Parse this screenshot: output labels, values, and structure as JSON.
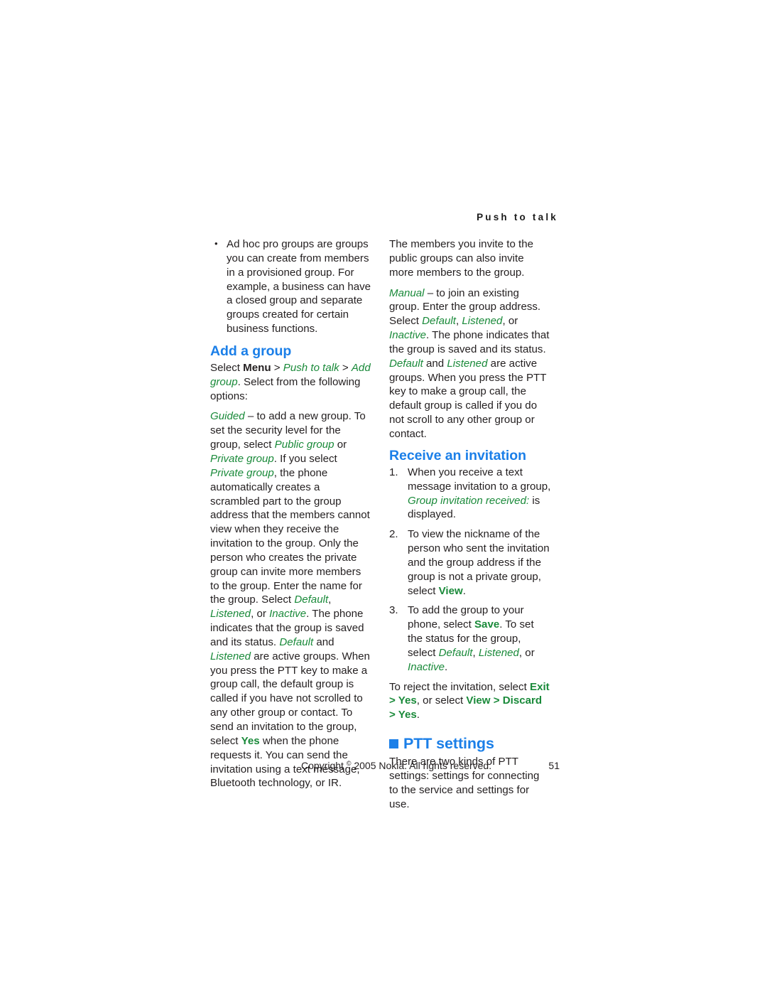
{
  "header": {
    "running_head": "Push to talk"
  },
  "left_column": {
    "bullet_items": [
      "Ad hoc pro groups are groups you can create from members in a provisioned group. For example, a business can have a closed group and separate groups created for certain business functions."
    ],
    "heading_add_group": "Add a group",
    "select_para": {
      "t1": "Select ",
      "menu": "Menu",
      "t2": " > ",
      "push_to_talk": "Push to talk",
      "t3": " > ",
      "add_group": "Add group",
      "t4": ". Select from the following options:"
    },
    "guided_para": {
      "guided": "Guided",
      "t1": " – to add a new group. To set the security level for the group, select ",
      "public_group": "Public group",
      "t2": " or ",
      "private_group": "Private group",
      "t3": ". If you select ",
      "private_group2": "Private group",
      "t4": ", the phone automatically creates a scrambled part to the group address that the members cannot view when they receive the invitation to the group. Only the person who creates the private group can invite more members to the group. Enter the name for the group. Select ",
      "default1": "Default",
      "t5": ", ",
      "listened1": "Listened",
      "t6": ", or ",
      "inactive1": "Inactive",
      "t7": ". The phone indicates that the group is saved and its status. ",
      "default2": "Default",
      "t8": " and ",
      "listened2": "Listened",
      "t9": " are active groups. When you press the PTT key to make a group call, the default group is called if you have not scrolled to any other group or contact. To send an invitation to the group, select ",
      "yes": "Yes",
      "t10": " when the phone requests it. You can send the invitation using a text message, Bluetooth technology, or IR."
    }
  },
  "right_column": {
    "members_para": "The members you invite to the public groups can also invite more members to the group.",
    "manual_para": {
      "manual": "Manual",
      "t1": " – to join an existing group. Enter the group address. Select ",
      "default1": "Default",
      "t2": ", ",
      "listened1": "Listened",
      "t3": ", or ",
      "inactive1": "Inactive",
      "t4": ". The phone indicates that the group is saved and its status. ",
      "default2": "Default",
      "t5": " and ",
      "listened2": "Listened",
      "t6": " are active groups. When you press the PTT key to make a group call, the default group is called if you do not scroll to any other group or contact."
    },
    "heading_receive_invitation": "Receive an invitation",
    "steps": [
      {
        "num": "1.",
        "t1": "When you receive a text message invitation to a group, ",
        "em1": "Group invitation received:",
        "t2": " is displayed."
      },
      {
        "num": "2.",
        "t1": "To view the nickname of the person who sent the invitation and the group address if the group is not a private group, select ",
        "strong1": "View",
        "t2": "."
      },
      {
        "num": "3.",
        "t1": "To add the group to your phone, select ",
        "strong1": "Save",
        "t2": ". To set the status for the group, select ",
        "em1": "Default",
        "t3": ", ",
        "em2": "Listened",
        "t4": ", or ",
        "em3": "Inactive",
        "t5": "."
      }
    ],
    "reject_para": {
      "t1": "To reject the invitation, select ",
      "exit": "Exit",
      "t2": " > ",
      "yes1": "Yes",
      "t3": ", or select ",
      "view": "View",
      "t4": " > ",
      "discard": "Discard",
      "t5": " > ",
      "yes2": "Yes",
      "t6": "."
    },
    "heading_ptt_settings": "PTT settings",
    "ptt_para": "There are two kinds of PTT settings: settings for connecting to the service and settings for use."
  },
  "footer": {
    "copyright_prefix": "Copyright ",
    "copyright_symbol": "©",
    "copyright_rest": " 2005 Nokia. All rights reserved.",
    "page_number": "51"
  },
  "colors": {
    "heading_blue": "#1b7fe8",
    "ui_green": "#1a8a3a",
    "body_text": "#231f20"
  }
}
